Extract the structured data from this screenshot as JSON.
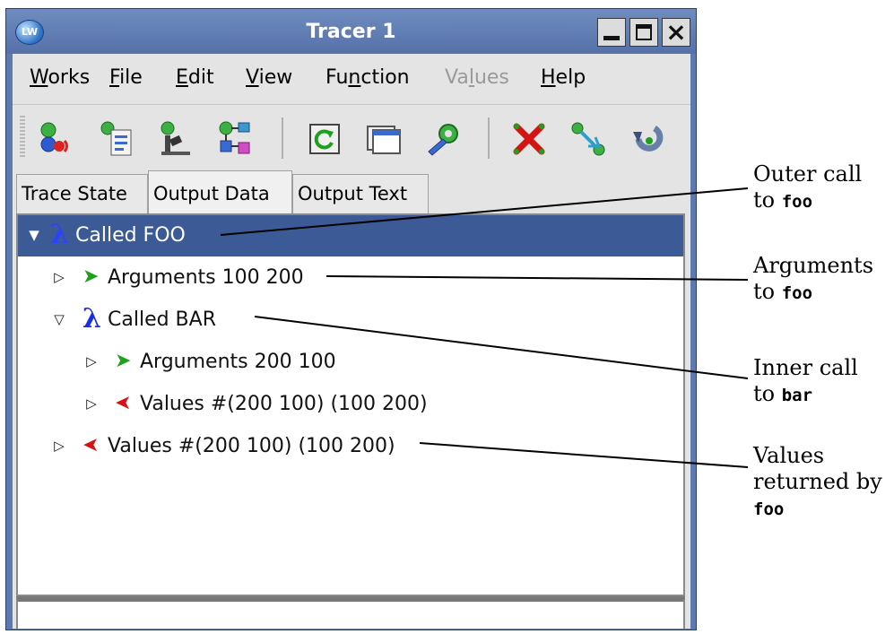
{
  "window": {
    "title": "Tracer 1",
    "app_badge": "LW"
  },
  "menubar": {
    "items": [
      {
        "label": "Works",
        "underline": "W",
        "rest": "orks",
        "enabled": true
      },
      {
        "label": "File",
        "underline": "F",
        "rest": "ile",
        "enabled": true
      },
      {
        "label": "Edit",
        "underline": "E",
        "rest": "dit",
        "enabled": true
      },
      {
        "label": "View",
        "underline": "V",
        "rest": "iew",
        "enabled": true
      },
      {
        "label": "Function",
        "pre": "Fu",
        "underline": "n",
        "rest": "ction",
        "enabled": true
      },
      {
        "label": "Values",
        "pre": "Va",
        "underline": "l",
        "rest": "ues",
        "enabled": false
      },
      {
        "label": "Help",
        "underline": "H",
        "rest": "elp",
        "enabled": true
      }
    ]
  },
  "toolbar": {
    "buttons": [
      "trace-start-icon",
      "trace-script-icon",
      "inspect-icon",
      "tree-view-icon",
      "refresh-icon",
      "window-icon",
      "gear-icon",
      "delete-icon",
      "connect-icon",
      "undo-icon"
    ]
  },
  "tabs": [
    {
      "label": "Trace State",
      "active": false
    },
    {
      "label": "Output Data",
      "active": true
    },
    {
      "label": "Output Text",
      "active": false
    }
  ],
  "tree": {
    "rows": [
      {
        "label": "Called FOO",
        "type": "call",
        "expanded": true,
        "selected": true,
        "depth": 0
      },
      {
        "label": "Arguments 100 200",
        "type": "args",
        "expanded": false,
        "selected": false,
        "depth": 1
      },
      {
        "label": "Called BAR",
        "type": "call",
        "expanded": true,
        "selected": false,
        "depth": 1
      },
      {
        "label": "Arguments 200 100",
        "type": "args",
        "expanded": false,
        "selected": false,
        "depth": 2
      },
      {
        "label": "Values #(200 100) (100 200)",
        "type": "values",
        "expanded": false,
        "selected": false,
        "depth": 2
      },
      {
        "label": "Values #(200 100) (100 200)",
        "type": "values",
        "expanded": false,
        "selected": false,
        "depth": 1
      }
    ]
  },
  "annotations": [
    {
      "line1": "Outer call",
      "line2_prefix": "to ",
      "code": "foo"
    },
    {
      "line1": "Arguments",
      "line2_prefix": "to ",
      "code": "foo"
    },
    {
      "line1": "Inner call",
      "line2_prefix": "to ",
      "code": "bar"
    },
    {
      "line1": "Values",
      "line2": "returned by",
      "code": "foo"
    }
  ],
  "colors": {
    "titlebar": "#5c7ab0",
    "selection": "#3c5a96",
    "lambda": "#1a30e0",
    "args_arrow": "#1ea01e",
    "values_arrow": "#d21414"
  }
}
